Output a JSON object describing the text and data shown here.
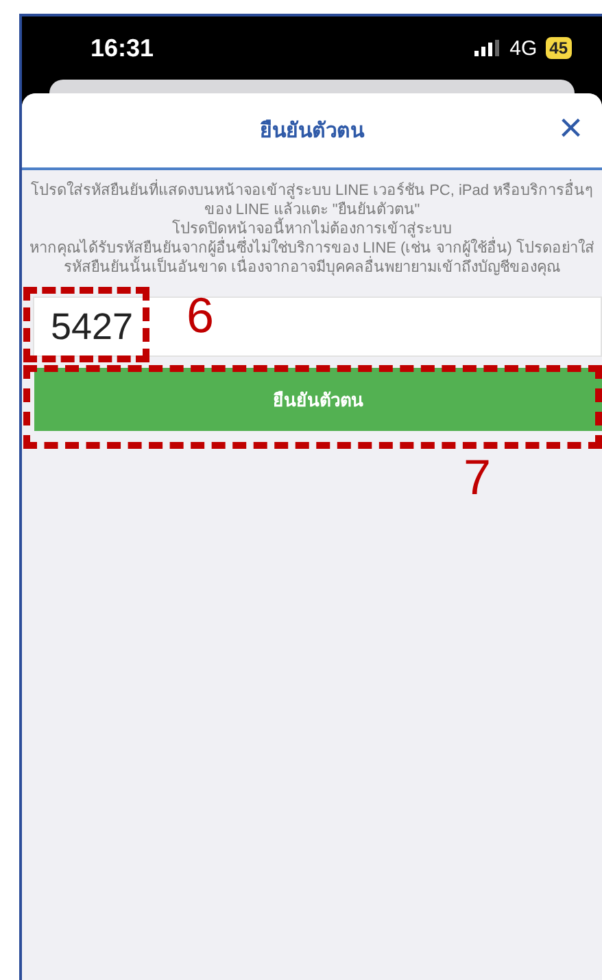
{
  "status_bar": {
    "time": "16:31",
    "network": "4G",
    "battery": "45"
  },
  "header": {
    "title": "ยืนยันตัวตน",
    "close": "×"
  },
  "instructions": [
    "โปรดใส่รหัสยืนยันที่แสดงบนหน้าจอเข้าสู่ระบบ LINE เวอร์ชัน PC, iPad หรือบริการอื่นๆ ของ LINE แล้วแตะ \"ยืนยันตัวตน\"",
    "โปรดปิดหน้าจอนี้หากไม่ต้องการเข้าสู่ระบบ",
    "หากคุณได้รับรหัสยืนยันจากผู้อื่นซึ่งไม่ใช่บริการของ LINE (เช่น จากผู้ใช้อื่น) โปรดอย่าใส่รหัสยืนยันนั้นเป็นอันขาด เนื่องจากอาจมีบุคคลอื่นพยายามเข้าถึงบัญชีของคุณ"
  ],
  "code_field": {
    "value": "5427"
  },
  "confirm_button": {
    "label": "ยืนยันตัวตน"
  },
  "annotations": [
    {
      "kind": "field",
      "label": "6"
    },
    {
      "kind": "button",
      "label": "7"
    }
  ]
}
